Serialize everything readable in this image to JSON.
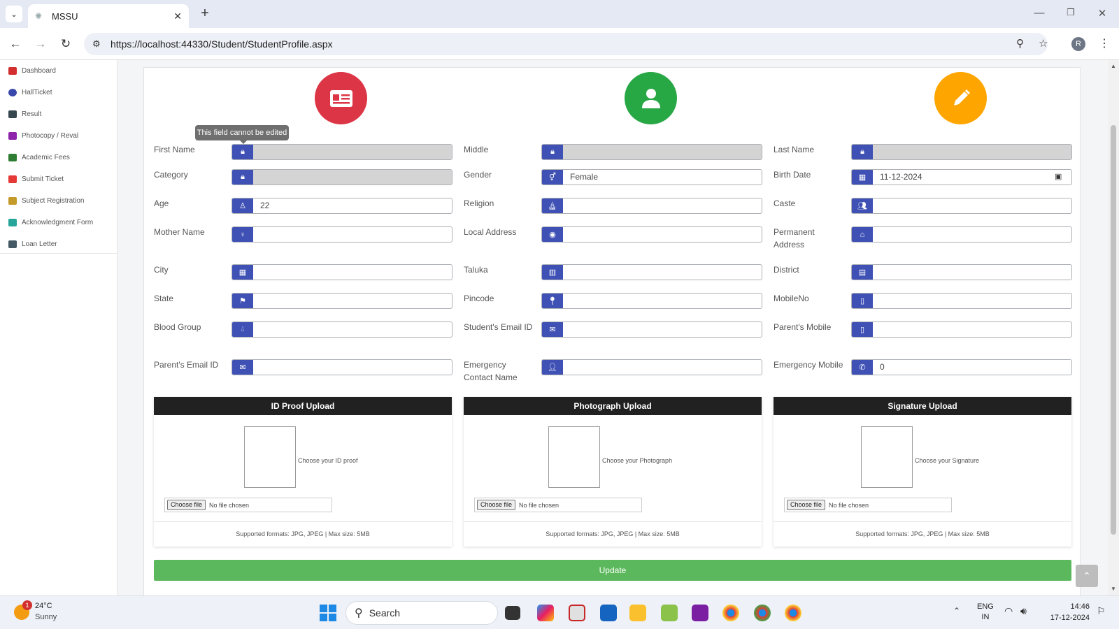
{
  "browser": {
    "tab_title": "MSSU",
    "url": "https://localhost:44330/Student/StudentProfile.aspx",
    "profile_initial": "R"
  },
  "sidebar": {
    "items": [
      {
        "label": "Dashboard",
        "color": "#d32f2f"
      },
      {
        "label": "HallTicket",
        "color": "#3949ab"
      },
      {
        "label": "Result",
        "color": "#37474f"
      },
      {
        "label": "Photocopy / Reval",
        "color": "#8e24aa"
      },
      {
        "label": "Academic Fees",
        "color": "#2e7d32"
      },
      {
        "label": "Submit Ticket",
        "color": "#e53935"
      },
      {
        "label": "Subject Registration",
        "color": "#c49a2a"
      },
      {
        "label": "Acknowledgment Form",
        "color": "#26a69a"
      },
      {
        "label": "Loan Letter",
        "color": "#455a64"
      }
    ]
  },
  "header_icons": {
    "id_card_color": "#dc3545",
    "user_color": "#28a745",
    "edit_color": "#ffa500"
  },
  "tooltip": "This field cannot be edited",
  "form": {
    "first_name": {
      "label": "First Name",
      "value": ""
    },
    "middle": {
      "label": "Middle",
      "value": ""
    },
    "last_name": {
      "label": "Last Name",
      "value": ""
    },
    "category": {
      "label": "Category",
      "value": ""
    },
    "gender": {
      "label": "Gender",
      "value": "Female"
    },
    "birth_date": {
      "label": "Birth Date",
      "value": "11-12-2024"
    },
    "age": {
      "label": "Age",
      "value": "22"
    },
    "religion": {
      "label": "Religion",
      "value": ""
    },
    "caste": {
      "label": "Caste",
      "value": ""
    },
    "mother_name": {
      "label": "Mother Name",
      "value": ""
    },
    "local_address": {
      "label": "Local Address",
      "value": ""
    },
    "permanent_address": {
      "label": "Permanent Address",
      "value": ""
    },
    "city": {
      "label": "City",
      "value": ""
    },
    "taluka": {
      "label": "Taluka",
      "value": ""
    },
    "district": {
      "label": "District",
      "value": ""
    },
    "state": {
      "label": "State",
      "value": ""
    },
    "pincode": {
      "label": "Pincode",
      "value": ""
    },
    "mobile_no": {
      "label": "MobileNo",
      "value": ""
    },
    "blood_group": {
      "label": "Blood Group",
      "value": ""
    },
    "student_email": {
      "label": "Student's Email ID",
      "value": ""
    },
    "parent_mobile": {
      "label": "Parent's Mobile",
      "value": ""
    },
    "parent_email": {
      "label": "Parent's Email ID",
      "value": ""
    },
    "emergency_name": {
      "label": "Emergency Contact Name",
      "value": ""
    },
    "emergency_mobile": {
      "label": "Emergency Mobile",
      "value": "0"
    }
  },
  "uploads": {
    "id_proof": {
      "title": "ID Proof Upload",
      "hint": "Choose your ID proof",
      "button": "Choose file",
      "status": "No file chosen",
      "footer": "Supported formats: JPG, JPEG | Max size: 5MB"
    },
    "photo": {
      "title": "Photograph Upload",
      "hint": "Choose your Photograph",
      "button": "Choose file",
      "status": "No file chosen",
      "footer": "Supported formats: JPG, JPEG | Max size: 5MB"
    },
    "signature": {
      "title": "Signature Upload",
      "hint": "Choose your Signature",
      "button": "Choose file",
      "status": "No file chosen",
      "footer": "Supported formats: JPG, JPEG | Max size: 5MB"
    }
  },
  "update_label": "Update",
  "taskbar": {
    "temperature": "24°C",
    "condition": "Sunny",
    "weather_badge": "1",
    "search_placeholder": "Search",
    "lang_line1": "ENG",
    "lang_line2": "IN",
    "time": "14:46",
    "date": "17-12-2024"
  }
}
